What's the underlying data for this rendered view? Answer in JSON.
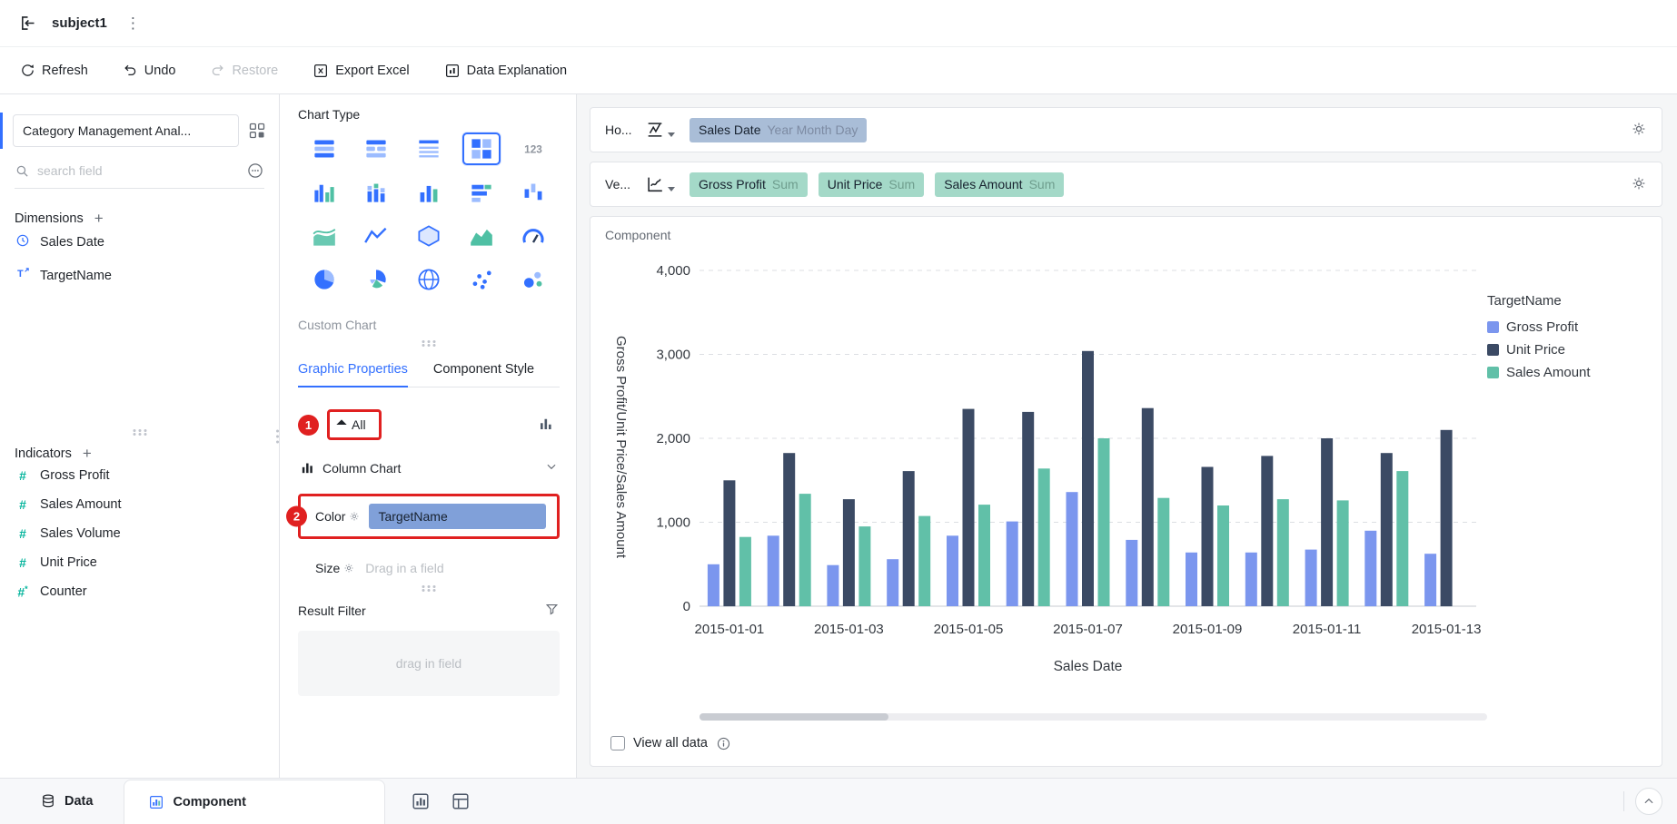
{
  "window": {
    "title": "subject1"
  },
  "toolbar": {
    "refresh": "Refresh",
    "undo": "Undo",
    "restore": "Restore",
    "export_excel": "Export Excel",
    "data_explanation": "Data Explanation"
  },
  "sidebar": {
    "dataset_selector": "Category Management Anal...",
    "search_placeholder": "search field",
    "dimensions": {
      "title": "Dimensions",
      "items": [
        {
          "label": "Sales Date",
          "icon": "clock-icon"
        },
        {
          "label": "TargetName",
          "icon": "text-field-icon"
        }
      ]
    },
    "indicators": {
      "title": "Indicators",
      "items": [
        {
          "label": "Gross Profit",
          "icon": "hash-icon"
        },
        {
          "label": "Sales Amount",
          "icon": "hash-icon"
        },
        {
          "label": "Sales Volume",
          "icon": "hash-icon"
        },
        {
          "label": "Unit Price",
          "icon": "hash-icon"
        },
        {
          "label": "Counter",
          "icon": "hash-star-icon"
        }
      ]
    }
  },
  "chart_panel": {
    "chart_type_label": "Chart Type",
    "chart_types": [
      "summary-table",
      "info-table",
      "detail-table",
      "quadrant",
      "indicator-card",
      "grouped-bar",
      "stacked-bar",
      "bar",
      "stacked-horizontal-bar",
      "range-bar",
      "stream-area",
      "line",
      "radar",
      "area",
      "gauge",
      "pie",
      "rose-pie",
      "map",
      "scatter",
      "bubble"
    ],
    "selected_index": 3,
    "custom_chart_label": "Custom Chart",
    "tabs": [
      "Graphic Properties",
      "Component Style"
    ],
    "all_label": "All",
    "chart_kind": "Column Chart",
    "color_label": "Color",
    "color_field": "TargetName",
    "size_label": "Size",
    "size_placeholder": "Drag in a field",
    "result_filter_label": "Result Filter",
    "result_filter_placeholder": "drag in field"
  },
  "axes": {
    "horizontal": {
      "label": "Ho...",
      "pills": [
        {
          "name": "Sales Date",
          "suffix": "Year Month Day"
        }
      ]
    },
    "vertical": {
      "label": "Ve...",
      "pills": [
        {
          "name": "Gross Profit",
          "suffix": "Sum"
        },
        {
          "name": "Unit Price",
          "suffix": "Sum"
        },
        {
          "name": "Sales Amount",
          "suffix": "Sum"
        }
      ]
    }
  },
  "component": {
    "title": "Component",
    "view_all_data": "View all data"
  },
  "chart_data": {
    "type": "bar",
    "title": "Component",
    "categories": [
      "2015-01-01",
      "2015-01-02",
      "2015-01-03",
      "2015-01-04",
      "2015-01-05",
      "2015-01-06",
      "2015-01-07",
      "2015-01-08",
      "2015-01-09",
      "2015-01-10",
      "2015-01-11",
      "2015-01-12",
      "2015-01-13"
    ],
    "x_tick_labels_shown": [
      "2015-01-01",
      "2015-01-03",
      "2015-01-05",
      "2015-01-07",
      "2015-01-09",
      "2015-01-11",
      "2015-01-13"
    ],
    "series": [
      {
        "name": "Gross Profit",
        "color": "#7b96ee",
        "values": [
          500,
          840,
          490,
          560,
          840,
          1010,
          1360,
          790,
          640,
          640,
          675,
          900,
          625
        ]
      },
      {
        "name": "Unit Price",
        "color": "#3b4a64",
        "values": [
          1500,
          1825,
          1275,
          1610,
          2350,
          2315,
          3040,
          2360,
          1660,
          1790,
          2000,
          1825,
          2100
        ]
      },
      {
        "name": "Sales Amount",
        "color": "#61c0a8",
        "values": [
          825,
          1340,
          950,
          1075,
          1210,
          1640,
          2000,
          1290,
          1200,
          1275,
          1260,
          1610,
          null
        ]
      }
    ],
    "xlabel": "Sales Date",
    "ylabel": "Gross Profit/Unit Price/Sales Amount",
    "ylim": [
      0,
      4000
    ],
    "ytick_interval": 1000,
    "legend_title": "TargetName",
    "legend_position": "right",
    "grid": "dashed-horizontal"
  },
  "bottom_bar": {
    "data_tab": "Data",
    "component_tab": "Component"
  },
  "annotations": {
    "badge1": "1",
    "badge2": "2"
  },
  "colors": {
    "accent": "#3370ff",
    "annotation_red": "#e02020",
    "pill_dimension": "#a9bdd7",
    "pill_measure": "#a4d9c8",
    "pill_color_field": "#80a0d9"
  }
}
